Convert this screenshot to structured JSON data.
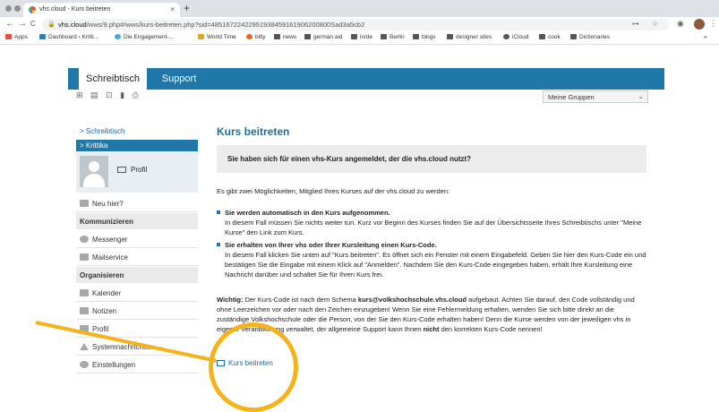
{
  "browser": {
    "tab_title": "vhs.cloud - Kurs beitreten",
    "tab_close": "×",
    "new_tab": "+",
    "nav": {
      "back": "←",
      "forward": "→",
      "reload": "C"
    },
    "url_host": "vhs.cloud",
    "url_rest": "/wws/9.php#/wws/kurs-beitreten.php?sid=48516722422951938459161906200800Sad3a5cb2",
    "url_icons": "⊶ ☆",
    "menu": "⋮"
  },
  "bookmarks": [
    "Apps",
    "Dashboard ‹ Kritti...",
    "Die Engagement-...",
    "World Time",
    "bitly",
    "news",
    "german aid",
    "in/de",
    "Berlin",
    "blogs",
    "designer sites",
    "iCloud",
    "cook",
    "Dictionaries"
  ],
  "bookmarks_more": "»",
  "topnav": {
    "tab_active": "Schreibtisch",
    "tab_support": "Support"
  },
  "toolbar_icons": "⊞ ▤ ⊡ ▮ ⎙",
  "group_select": {
    "value": "Meine Gruppen",
    "chevron": "⌄"
  },
  "sidebar": {
    "schreibtisch": "> Schreibtisch",
    "krittika": "> Krittika",
    "profil_link": "Profil",
    "neu_hier": "Neu hier?",
    "section_kommunizieren": "Kommunizieren",
    "messenger": "Messenger",
    "mailservice": "Mailservice",
    "section_organisieren": "Organisieren",
    "kalender": "Kalender",
    "notizen": "Notizen",
    "profil": "Profil",
    "systemnachrichten": "Systemnachrichten",
    "einstellungen": "Einstellungen"
  },
  "main": {
    "title": "Kurs beitreten",
    "notice": "Sie haben sich für einen vhs-Kurs angemeldet, der die vhs.cloud nutzt?",
    "intro": "Es gibt zwei Möglichkeiten, Mitglied Ihres Kurses auf der vhs.cloud zu werden:",
    "bullet1_title": "Sie werden automatisch in den Kurs aufgenommen.",
    "bullet1_body": "In diesem Fall müssen Sie nichts weiter tun. Kurz vor Beginn des Kurses finden Sie auf der Übersichtsseite Ihres Schreibtischs unter \"Meine Kurse\" den Link zum Kurs.",
    "bullet2_title": "Sie erhalten von Ihrer vhs oder Ihrer Kursleitung einen Kurs-Code.",
    "bullet2_body": "In diesem Fall klicken Sie unten auf \"Kurs beitreten\". Es öffnet sich ein Fenster mit einem Eingabefeld. Geben Sie hier den Kurs-Code ein und bestätigen Sie die Eingabe mit einem Klick auf \"Anmelden\". Nachdem Sie den Kurs-Code eingegeben haben, erhält Ihre Kursleitung eine Nachricht darüber und schaltet Sie für Ihren Kurs frei.",
    "note_label": "Wichtig:",
    "note_part1": " Der Kurs-Code ist nach dem Schema ",
    "note_schema": "kurs@volkshochschule.vhs.cloud",
    "note_part2": " aufgebaut. Achten Sie darauf, den Code vollständig und ohne Leerzeichen vor oder nach den Zeichen einzugeben! Wenn Sie eine Fehlermeldung erhalten, wenden Sie sich bitte direkt an die zuständige Volkshochschule oder die Person, von der Sie den Kurs-Code erhalten haben! Denn die Kurse werden von der jeweiligen vhs in eigener Verantwortung verwaltet, der allgemeine Support kann Ihnen ",
    "note_nicht": "nicht",
    "note_part3": " den korrekten Kurs-Code nennen!",
    "join_link": "Kurs beitreten"
  },
  "colors": {
    "primary": "#1f78a8",
    "highlight": "#f5b21b"
  }
}
